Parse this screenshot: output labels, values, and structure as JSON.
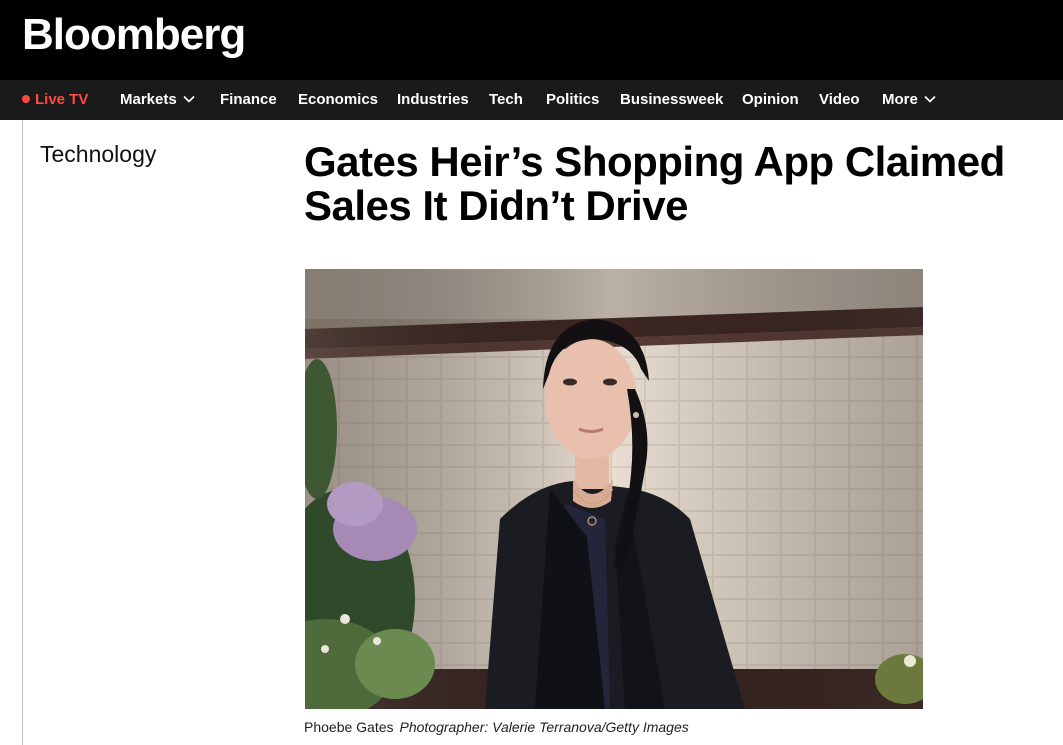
{
  "header": {
    "logo": "Bloomberg"
  },
  "nav": {
    "live": "Live TV",
    "items": [
      {
        "label": "Markets",
        "dropdown": true
      },
      {
        "label": "Finance"
      },
      {
        "label": "Economics"
      },
      {
        "label": "Industries"
      },
      {
        "label": "Tech"
      },
      {
        "label": "Politics"
      },
      {
        "label": "Businessweek"
      },
      {
        "label": "Opinion"
      },
      {
        "label": "Video"
      },
      {
        "label": "More",
        "dropdown": true
      }
    ]
  },
  "article": {
    "section": "Technology",
    "headline": "Gates Heir’s Shopping App Claimed Sales It Didn’t Drive",
    "caption": "Phoebe Gates",
    "credit": "Photographer: Valerie Terranova/Getty Images"
  },
  "colors": {
    "topbar": "#000000",
    "navbar": "#1a1a1a",
    "live": "#ff4a44"
  },
  "icons": [
    "chevron-down-icon",
    "live-dot-icon"
  ]
}
